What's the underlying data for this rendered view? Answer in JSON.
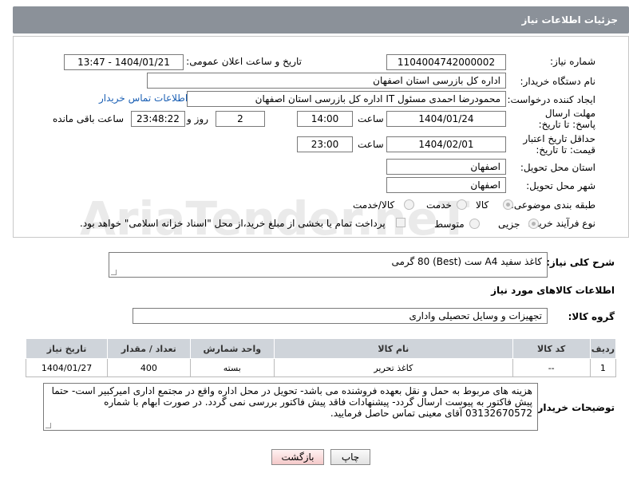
{
  "header": {
    "title": "جزئیات اطلاعات نیاز"
  },
  "fields": {
    "need_number_label": "شماره نیاز:",
    "need_number": "1104004742000002",
    "announce_label": "تاریخ و ساعت اعلان عمومی:",
    "announce_value": "1404/01/21 - 13:47",
    "buyer_org_label": "نام دستگاه خریدار:",
    "buyer_org": "اداره کل بازرسی استان اصفهان",
    "creator_label": "ایجاد کننده درخواست:",
    "creator": "محمودرضا احمدی مسئول IT اداره کل بازرسی استان اصفهان",
    "contact_link": "اطلاعات تماس خریدار",
    "deadline_label": "مهلت ارسال پاسخ: تا تاریخ:",
    "deadline_date": "1404/01/24",
    "time_label": "ساعت",
    "deadline_time": "14:00",
    "days_value": "2",
    "days_label": "روز و",
    "remaining_time": "23:48:22",
    "remaining_label": "ساعت باقی مانده",
    "validity_label": "حداقل تاریخ اعتبار قیمت: تا تاریخ:",
    "validity_date": "1404/02/01",
    "validity_time_label": "ساعت",
    "validity_time": "23:00",
    "province_label": "استان محل تحویل:",
    "province": "اصفهان",
    "city_label": "شهر محل تحویل:",
    "city": "اصفهان",
    "category_label": "طبقه بندی موضوعی:",
    "category_options": [
      "کالا",
      "خدمت",
      "کالا/خدمت"
    ],
    "process_label": "نوع فرآیند خرید :",
    "process_options": [
      "جزیی",
      "متوسط"
    ],
    "payment_note": "پرداخت تمام یا بخشی از مبلغ خرید،از محل \"اسناد خزانه اسلامی\" خواهد بود."
  },
  "description": {
    "label": "شرح کلی نیاز:",
    "value": "کاغذ سفید A4 ست (Best) 80 گرمی"
  },
  "goods_section": {
    "title": "اطلاعات کالاهای مورد نیاز",
    "group_label": "گروه کالا:",
    "group_value": "تجهیزات و وسایل تحصیلی واداری"
  },
  "table": {
    "headers": [
      "ردیف",
      "کد کالا",
      "نام کالا",
      "واحد شمارش",
      "تعداد / مقدار",
      "تاریخ نیاز"
    ],
    "rows": [
      [
        "1",
        "--",
        "کاغذ تحریر",
        "بسته",
        "400",
        "1404/01/27"
      ]
    ]
  },
  "buyer_notes": {
    "label": "توضیحات خریدار:",
    "value": "هزینه های مربوط به حمل و نقل بعهده فروشنده می باشد- تحویل در محل اداره واقع در مجتمع اداری امیرکبیر است- حتما پیش فاکتور به پیوست ارسال گردد- پیشنهادات فاقد پیش فاکتور بررسی نمی گردد. در صورت ابهام با شماره 03132670572 آقای معینی تماس حاصل فرمایید."
  },
  "buttons": {
    "print": "چاپ",
    "back": "بازگشت"
  },
  "watermark": "AriaTender.neT"
}
